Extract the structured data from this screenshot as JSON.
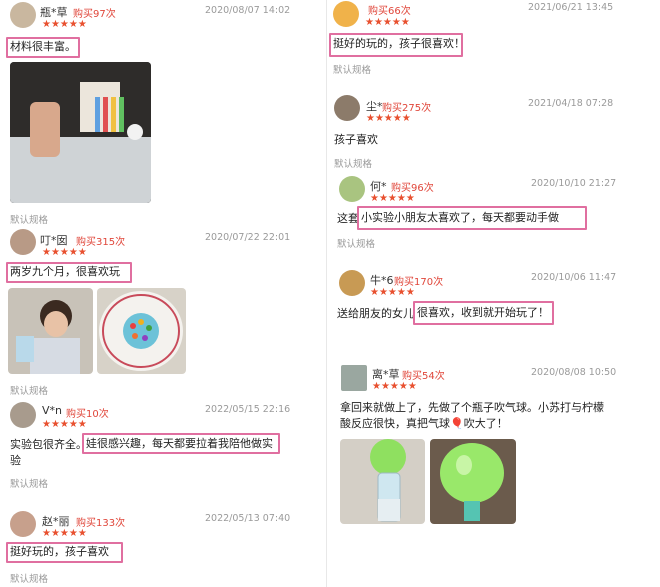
{
  "reviews_left": [
    {
      "user": "瓶*草",
      "bought": "购买97次",
      "date": "2020/08/07 14:02",
      "stars": "★★★★★",
      "text": "材料很丰富。",
      "spec": "默认规格"
    },
    {
      "user": "叮*囡",
      "bought": "购买315次",
      "date": "2020/07/22 22:01",
      "stars": "★★★★★",
      "text": "两岁九个月，很喜欢玩",
      "spec": "默认规格"
    },
    {
      "user": "V*n",
      "bought": "购买10次",
      "date": "2022/05/15 22:16",
      "stars": "★★★★★",
      "text_a": "实验包很齐全。",
      "text_b": "娃很感兴趣，每天都要拉着我陪他做实",
      "text_c": "验",
      "spec": "默认规格"
    },
    {
      "user": "赵*丽",
      "bought": "购买133次",
      "date": "2022/05/13 07:40",
      "stars": "★★★★★",
      "text": "挺好玩的，孩子喜欢",
      "spec": "默认规格"
    }
  ],
  "reviews_right": [
    {
      "user": "",
      "bought": "购买66次",
      "date": "2021/06/21 13:45",
      "stars": "★★★★★",
      "text": "挺好的玩的，孩子很喜欢！",
      "spec": "默认规格"
    },
    {
      "user": "尘*",
      "bought": "购买275次",
      "date": "2021/04/18 07:28",
      "stars": "★★★★★",
      "text": "孩子喜欢",
      "spec": "默认规格"
    },
    {
      "user": "何*",
      "bought": "购买96次",
      "date": "2020/10/10 21:27",
      "stars": "★★★★★",
      "text_a": "这套",
      "text_b": "小实验小朋友太喜欢了，每天都要动手做",
      "spec": "默认规格"
    },
    {
      "user": "牛*6",
      "bought": "购买170次",
      "date": "2020/10/06 11:47",
      "stars": "★★★★★",
      "text_a": "送给朋友的女儿",
      "text_b": "很喜欢，收到就开始玩了！",
      "spec": ""
    },
    {
      "user": "离*草",
      "bought": "购买54次",
      "date": "2020/08/08 10:50",
      "stars": "★★★★★",
      "text_line1": "拿回来就做上了，先做了个瓶子吹气球。小苏打与柠檬",
      "text_line2": "酸反应很快，真把气球🎈吹大了！",
      "spec": ""
    }
  ]
}
